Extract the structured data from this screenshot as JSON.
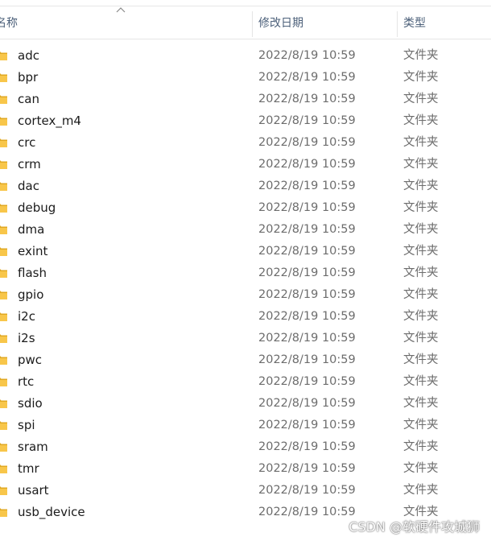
{
  "columns": {
    "name": "名称",
    "modified": "修改日期",
    "type": "类型"
  },
  "colors": {
    "folder": "#f8c64a",
    "folder_dark": "#e0a822",
    "header_text": "#4c607a"
  },
  "files": [
    {
      "name": "adc",
      "modified": "2022/8/19 10:59",
      "type": "文件夹"
    },
    {
      "name": "bpr",
      "modified": "2022/8/19 10:59",
      "type": "文件夹"
    },
    {
      "name": "can",
      "modified": "2022/8/19 10:59",
      "type": "文件夹"
    },
    {
      "name": "cortex_m4",
      "modified": "2022/8/19 10:59",
      "type": "文件夹"
    },
    {
      "name": "crc",
      "modified": "2022/8/19 10:59",
      "type": "文件夹"
    },
    {
      "name": "crm",
      "modified": "2022/8/19 10:59",
      "type": "文件夹"
    },
    {
      "name": "dac",
      "modified": "2022/8/19 10:59",
      "type": "文件夹"
    },
    {
      "name": "debug",
      "modified": "2022/8/19 10:59",
      "type": "文件夹"
    },
    {
      "name": "dma",
      "modified": "2022/8/19 10:59",
      "type": "文件夹"
    },
    {
      "name": "exint",
      "modified": "2022/8/19 10:59",
      "type": "文件夹"
    },
    {
      "name": "flash",
      "modified": "2022/8/19 10:59",
      "type": "文件夹"
    },
    {
      "name": "gpio",
      "modified": "2022/8/19 10:59",
      "type": "文件夹"
    },
    {
      "name": "i2c",
      "modified": "2022/8/19 10:59",
      "type": "文件夹"
    },
    {
      "name": "i2s",
      "modified": "2022/8/19 10:59",
      "type": "文件夹"
    },
    {
      "name": "pwc",
      "modified": "2022/8/19 10:59",
      "type": "文件夹"
    },
    {
      "name": "rtc",
      "modified": "2022/8/19 10:59",
      "type": "文件夹"
    },
    {
      "name": "sdio",
      "modified": "2022/8/19 10:59",
      "type": "文件夹"
    },
    {
      "name": "spi",
      "modified": "2022/8/19 10:59",
      "type": "文件夹"
    },
    {
      "name": "sram",
      "modified": "2022/8/19 10:59",
      "type": "文件夹"
    },
    {
      "name": "tmr",
      "modified": "2022/8/19 10:59",
      "type": "文件夹"
    },
    {
      "name": "usart",
      "modified": "2022/8/19 10:59",
      "type": "文件夹"
    },
    {
      "name": "usb_device",
      "modified": "2022/8/19 10:59",
      "type": "文件夹"
    }
  ],
  "watermark": "CSDN @软硬件攻城狮",
  "icons": {
    "sort": "chevron-up-icon",
    "folder": "folder-icon"
  }
}
